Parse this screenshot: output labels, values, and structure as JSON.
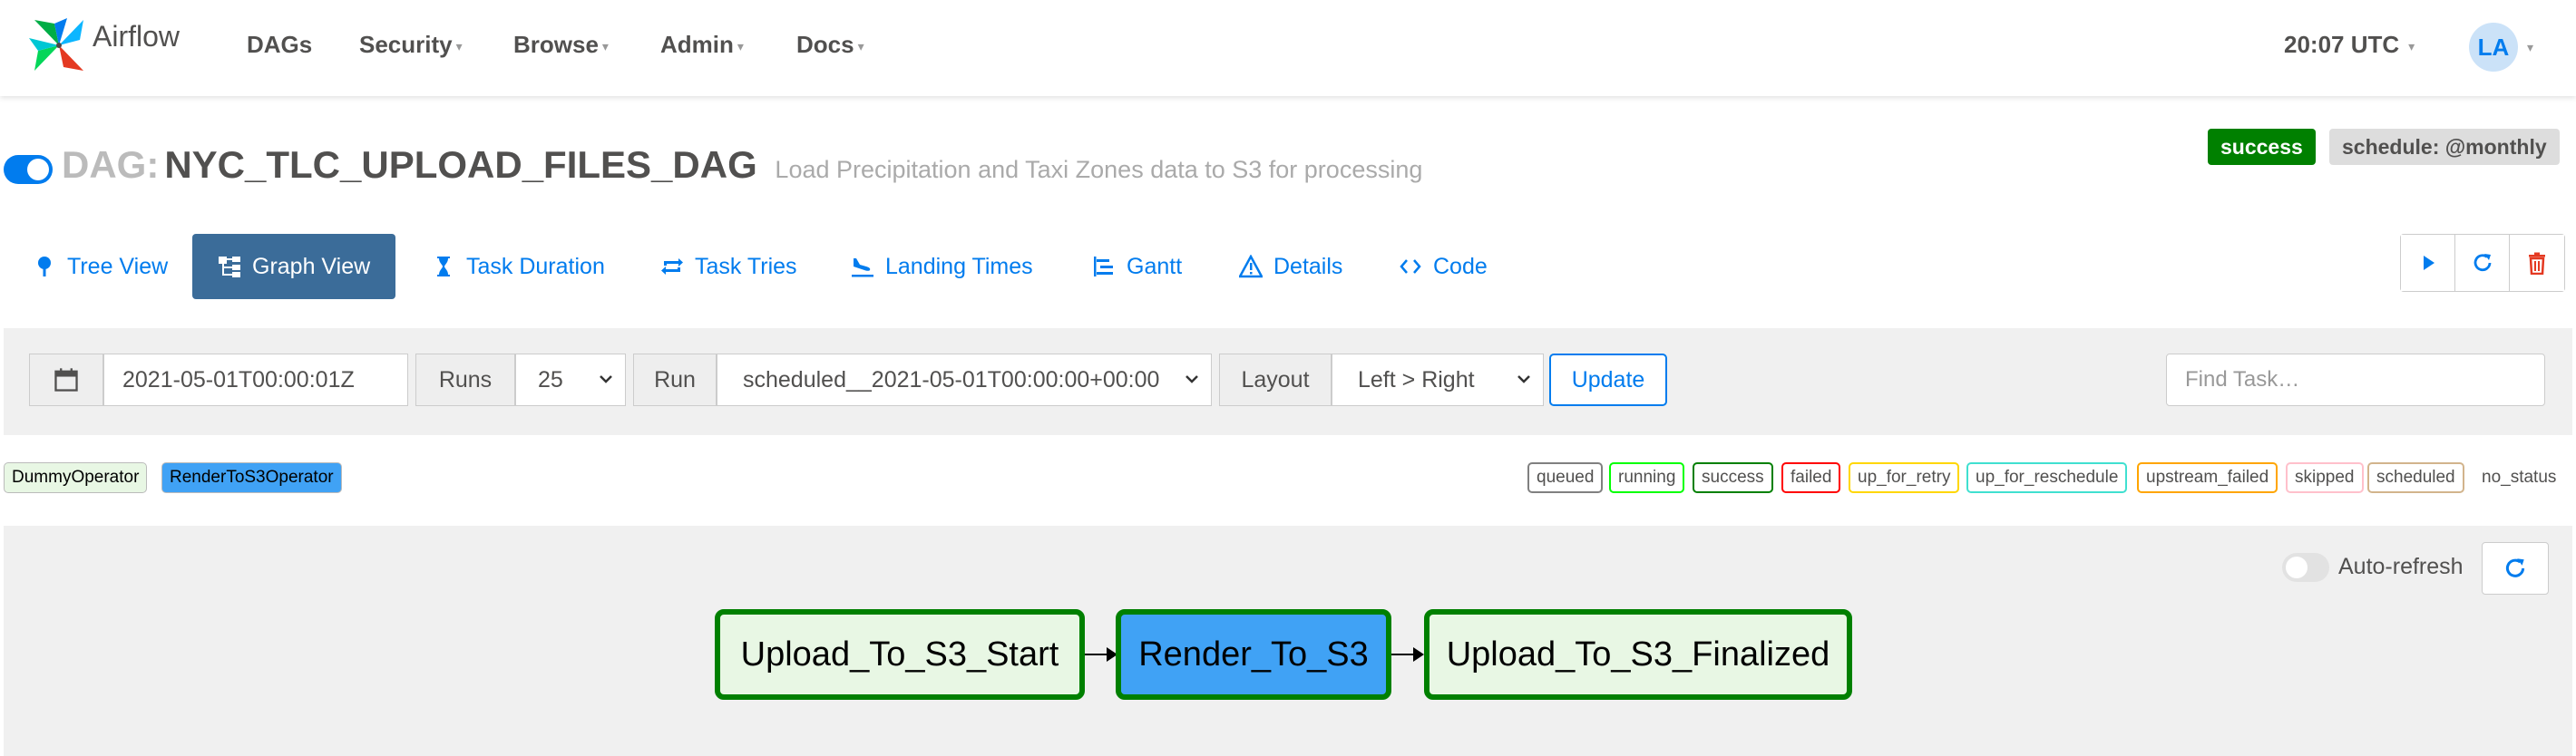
{
  "app": {
    "brand": "Airflow"
  },
  "navbar": {
    "items": [
      {
        "label": "DAGs",
        "dropdown": false
      },
      {
        "label": "Security",
        "dropdown": true
      },
      {
        "label": "Browse",
        "dropdown": true
      },
      {
        "label": "Admin",
        "dropdown": true
      },
      {
        "label": "Docs",
        "dropdown": true
      }
    ],
    "time": "20:07 UTC",
    "user_initials": "LA"
  },
  "dag": {
    "prefix": "DAG:",
    "id": "NYC_TLC_UPLOAD_FILES_DAG",
    "description": "Load Precipitation and Taxi Zones data to S3 for processing",
    "paused": false,
    "state_badge": "success",
    "schedule_badge": "schedule: @monthly"
  },
  "tabs": [
    {
      "label": "Tree View",
      "icon": "tree-icon",
      "active": false
    },
    {
      "label": "Graph View",
      "icon": "graph-icon",
      "active": true
    },
    {
      "label": "Task Duration",
      "icon": "hourglass-icon",
      "active": false
    },
    {
      "label": "Task Tries",
      "icon": "retry-icon",
      "active": false
    },
    {
      "label": "Landing Times",
      "icon": "plane-landing-icon",
      "active": false
    },
    {
      "label": "Gantt",
      "icon": "gantt-icon",
      "active": false
    },
    {
      "label": "Details",
      "icon": "warning-triangle-icon",
      "active": false
    },
    {
      "label": "Code",
      "icon": "code-icon",
      "active": false
    }
  ],
  "actions": {
    "trigger_icon": "play-icon",
    "refresh_icon": "refresh-icon",
    "delete_icon": "trash-icon"
  },
  "filters": {
    "base_date": "2021-05-01T00:00:01Z",
    "runs_label": "Runs",
    "runs_value": "25",
    "run_label": "Run",
    "run_value": "scheduled__2021-05-01T00:00:00+00:00",
    "layout_label": "Layout",
    "layout_value": "Left > Right",
    "update_label": "Update",
    "find_task_placeholder": "Find Task…"
  },
  "operator_legend": [
    {
      "label": "DummyOperator",
      "color": "#e8f7e4"
    },
    {
      "label": "RenderToS3Operator",
      "color": "#40a2f5"
    }
  ],
  "state_legend": [
    {
      "label": "queued",
      "color": "#808080"
    },
    {
      "label": "running",
      "color": "#00ff00"
    },
    {
      "label": "success",
      "color": "#008000"
    },
    {
      "label": "failed",
      "color": "#ff0000"
    },
    {
      "label": "up_for_retry",
      "color": "#ffd700"
    },
    {
      "label": "up_for_reschedule",
      "color": "#40e0d0"
    },
    {
      "label": "upstream_failed",
      "color": "#ffa500"
    },
    {
      "label": "skipped",
      "color": "#ffc0cb"
    },
    {
      "label": "scheduled",
      "color": "#d2b48c"
    },
    {
      "label": "no_status",
      "color": "#ffffff"
    }
  ],
  "graph": {
    "auto_refresh_label": "Auto-refresh",
    "auto_refresh_on": false,
    "nodes": [
      {
        "label": "Upload_To_S3_Start",
        "fill": "#e8f7e4",
        "state_color": "#008000"
      },
      {
        "label": "Render_To_S3",
        "fill": "#40a2f5",
        "state_color": "#008000"
      },
      {
        "label": "Upload_To_S3_Finalized",
        "fill": "#e8f7e4",
        "state_color": "#008000"
      }
    ]
  },
  "colors": {
    "accent": "#017cee",
    "active_tab": "#3b6c99",
    "success": "#008000"
  }
}
